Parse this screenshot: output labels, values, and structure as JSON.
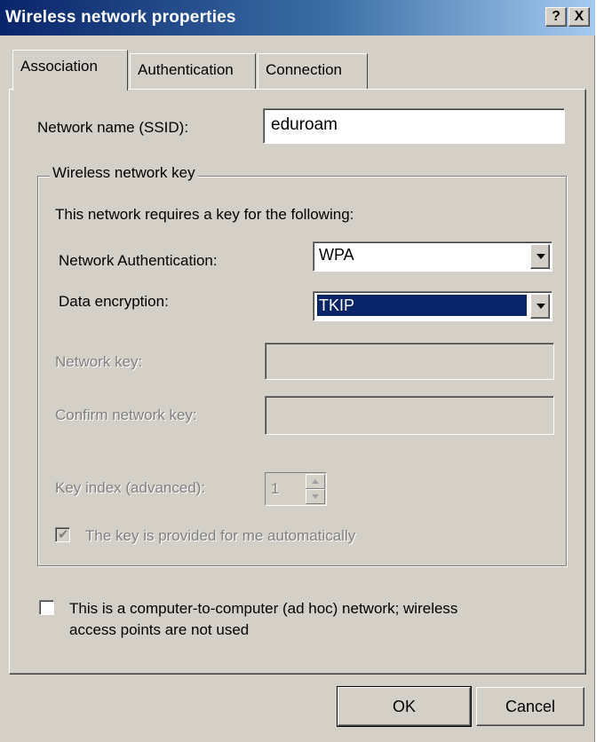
{
  "window": {
    "title": "Wireless network properties",
    "help_label": "?",
    "close_label": "X"
  },
  "tabs": [
    {
      "label": "Association",
      "active": true
    },
    {
      "label": "Authentication",
      "active": false
    },
    {
      "label": "Connection",
      "active": false
    }
  ],
  "association": {
    "ssid_label": "Network name (SSID):",
    "ssid_value": "eduroam",
    "group_label": "Wireless network key",
    "key_required_text": "This network requires a key for the following:",
    "auth_label": "Network Authentication:",
    "auth_value": "WPA",
    "encryption_label": "Data encryption:",
    "encryption_value": "TKIP",
    "network_key_label": "Network key:",
    "confirm_key_label": "Confirm network key:",
    "key_index_label": "Key index (advanced):",
    "key_index_value": "1",
    "auto_key_label": "The key is provided for me automatically",
    "auto_key_checked": true,
    "adhoc_label_line1": "This is a computer-to-computer (ad hoc) network; wireless",
    "adhoc_label_line2": "access points are not used",
    "adhoc_checked": false
  },
  "buttons": {
    "ok": "OK",
    "cancel": "Cancel"
  },
  "colors": {
    "face": "#d4d0c8",
    "title_start": "#0a246a",
    "title_end": "#a6caf0",
    "selection": "#0a246a"
  }
}
